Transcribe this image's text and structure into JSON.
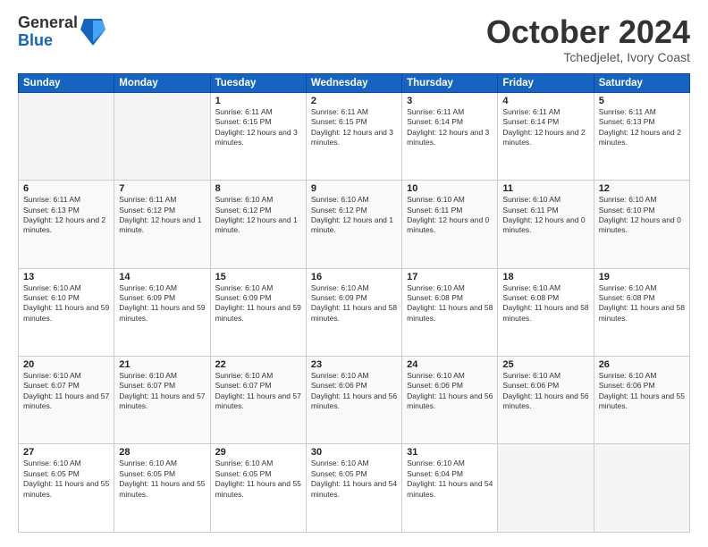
{
  "logo": {
    "general": "General",
    "blue": "Blue"
  },
  "title": "October 2024",
  "subtitle": "Tchedjelet, Ivory Coast",
  "days_of_week": [
    "Sunday",
    "Monday",
    "Tuesday",
    "Wednesday",
    "Thursday",
    "Friday",
    "Saturday"
  ],
  "weeks": [
    [
      {
        "day": "",
        "info": ""
      },
      {
        "day": "",
        "info": ""
      },
      {
        "day": "1",
        "info": "Sunrise: 6:11 AM\nSunset: 6:15 PM\nDaylight: 12 hours and 3 minutes."
      },
      {
        "day": "2",
        "info": "Sunrise: 6:11 AM\nSunset: 6:15 PM\nDaylight: 12 hours and 3 minutes."
      },
      {
        "day": "3",
        "info": "Sunrise: 6:11 AM\nSunset: 6:14 PM\nDaylight: 12 hours and 3 minutes."
      },
      {
        "day": "4",
        "info": "Sunrise: 6:11 AM\nSunset: 6:14 PM\nDaylight: 12 hours and 2 minutes."
      },
      {
        "day": "5",
        "info": "Sunrise: 6:11 AM\nSunset: 6:13 PM\nDaylight: 12 hours and 2 minutes."
      }
    ],
    [
      {
        "day": "6",
        "info": "Sunrise: 6:11 AM\nSunset: 6:13 PM\nDaylight: 12 hours and 2 minutes."
      },
      {
        "day": "7",
        "info": "Sunrise: 6:11 AM\nSunset: 6:12 PM\nDaylight: 12 hours and 1 minute."
      },
      {
        "day": "8",
        "info": "Sunrise: 6:10 AM\nSunset: 6:12 PM\nDaylight: 12 hours and 1 minute."
      },
      {
        "day": "9",
        "info": "Sunrise: 6:10 AM\nSunset: 6:12 PM\nDaylight: 12 hours and 1 minute."
      },
      {
        "day": "10",
        "info": "Sunrise: 6:10 AM\nSunset: 6:11 PM\nDaylight: 12 hours and 0 minutes."
      },
      {
        "day": "11",
        "info": "Sunrise: 6:10 AM\nSunset: 6:11 PM\nDaylight: 12 hours and 0 minutes."
      },
      {
        "day": "12",
        "info": "Sunrise: 6:10 AM\nSunset: 6:10 PM\nDaylight: 12 hours and 0 minutes."
      }
    ],
    [
      {
        "day": "13",
        "info": "Sunrise: 6:10 AM\nSunset: 6:10 PM\nDaylight: 11 hours and 59 minutes."
      },
      {
        "day": "14",
        "info": "Sunrise: 6:10 AM\nSunset: 6:09 PM\nDaylight: 11 hours and 59 minutes."
      },
      {
        "day": "15",
        "info": "Sunrise: 6:10 AM\nSunset: 6:09 PM\nDaylight: 11 hours and 59 minutes."
      },
      {
        "day": "16",
        "info": "Sunrise: 6:10 AM\nSunset: 6:09 PM\nDaylight: 11 hours and 58 minutes."
      },
      {
        "day": "17",
        "info": "Sunrise: 6:10 AM\nSunset: 6:08 PM\nDaylight: 11 hours and 58 minutes."
      },
      {
        "day": "18",
        "info": "Sunrise: 6:10 AM\nSunset: 6:08 PM\nDaylight: 11 hours and 58 minutes."
      },
      {
        "day": "19",
        "info": "Sunrise: 6:10 AM\nSunset: 6:08 PM\nDaylight: 11 hours and 58 minutes."
      }
    ],
    [
      {
        "day": "20",
        "info": "Sunrise: 6:10 AM\nSunset: 6:07 PM\nDaylight: 11 hours and 57 minutes."
      },
      {
        "day": "21",
        "info": "Sunrise: 6:10 AM\nSunset: 6:07 PM\nDaylight: 11 hours and 57 minutes."
      },
      {
        "day": "22",
        "info": "Sunrise: 6:10 AM\nSunset: 6:07 PM\nDaylight: 11 hours and 57 minutes."
      },
      {
        "day": "23",
        "info": "Sunrise: 6:10 AM\nSunset: 6:06 PM\nDaylight: 11 hours and 56 minutes."
      },
      {
        "day": "24",
        "info": "Sunrise: 6:10 AM\nSunset: 6:06 PM\nDaylight: 11 hours and 56 minutes."
      },
      {
        "day": "25",
        "info": "Sunrise: 6:10 AM\nSunset: 6:06 PM\nDaylight: 11 hours and 56 minutes."
      },
      {
        "day": "26",
        "info": "Sunrise: 6:10 AM\nSunset: 6:06 PM\nDaylight: 11 hours and 55 minutes."
      }
    ],
    [
      {
        "day": "27",
        "info": "Sunrise: 6:10 AM\nSunset: 6:05 PM\nDaylight: 11 hours and 55 minutes."
      },
      {
        "day": "28",
        "info": "Sunrise: 6:10 AM\nSunset: 6:05 PM\nDaylight: 11 hours and 55 minutes."
      },
      {
        "day": "29",
        "info": "Sunrise: 6:10 AM\nSunset: 6:05 PM\nDaylight: 11 hours and 55 minutes."
      },
      {
        "day": "30",
        "info": "Sunrise: 6:10 AM\nSunset: 6:05 PM\nDaylight: 11 hours and 54 minutes."
      },
      {
        "day": "31",
        "info": "Sunrise: 6:10 AM\nSunset: 6:04 PM\nDaylight: 11 hours and 54 minutes."
      },
      {
        "day": "",
        "info": ""
      },
      {
        "day": "",
        "info": ""
      }
    ]
  ]
}
